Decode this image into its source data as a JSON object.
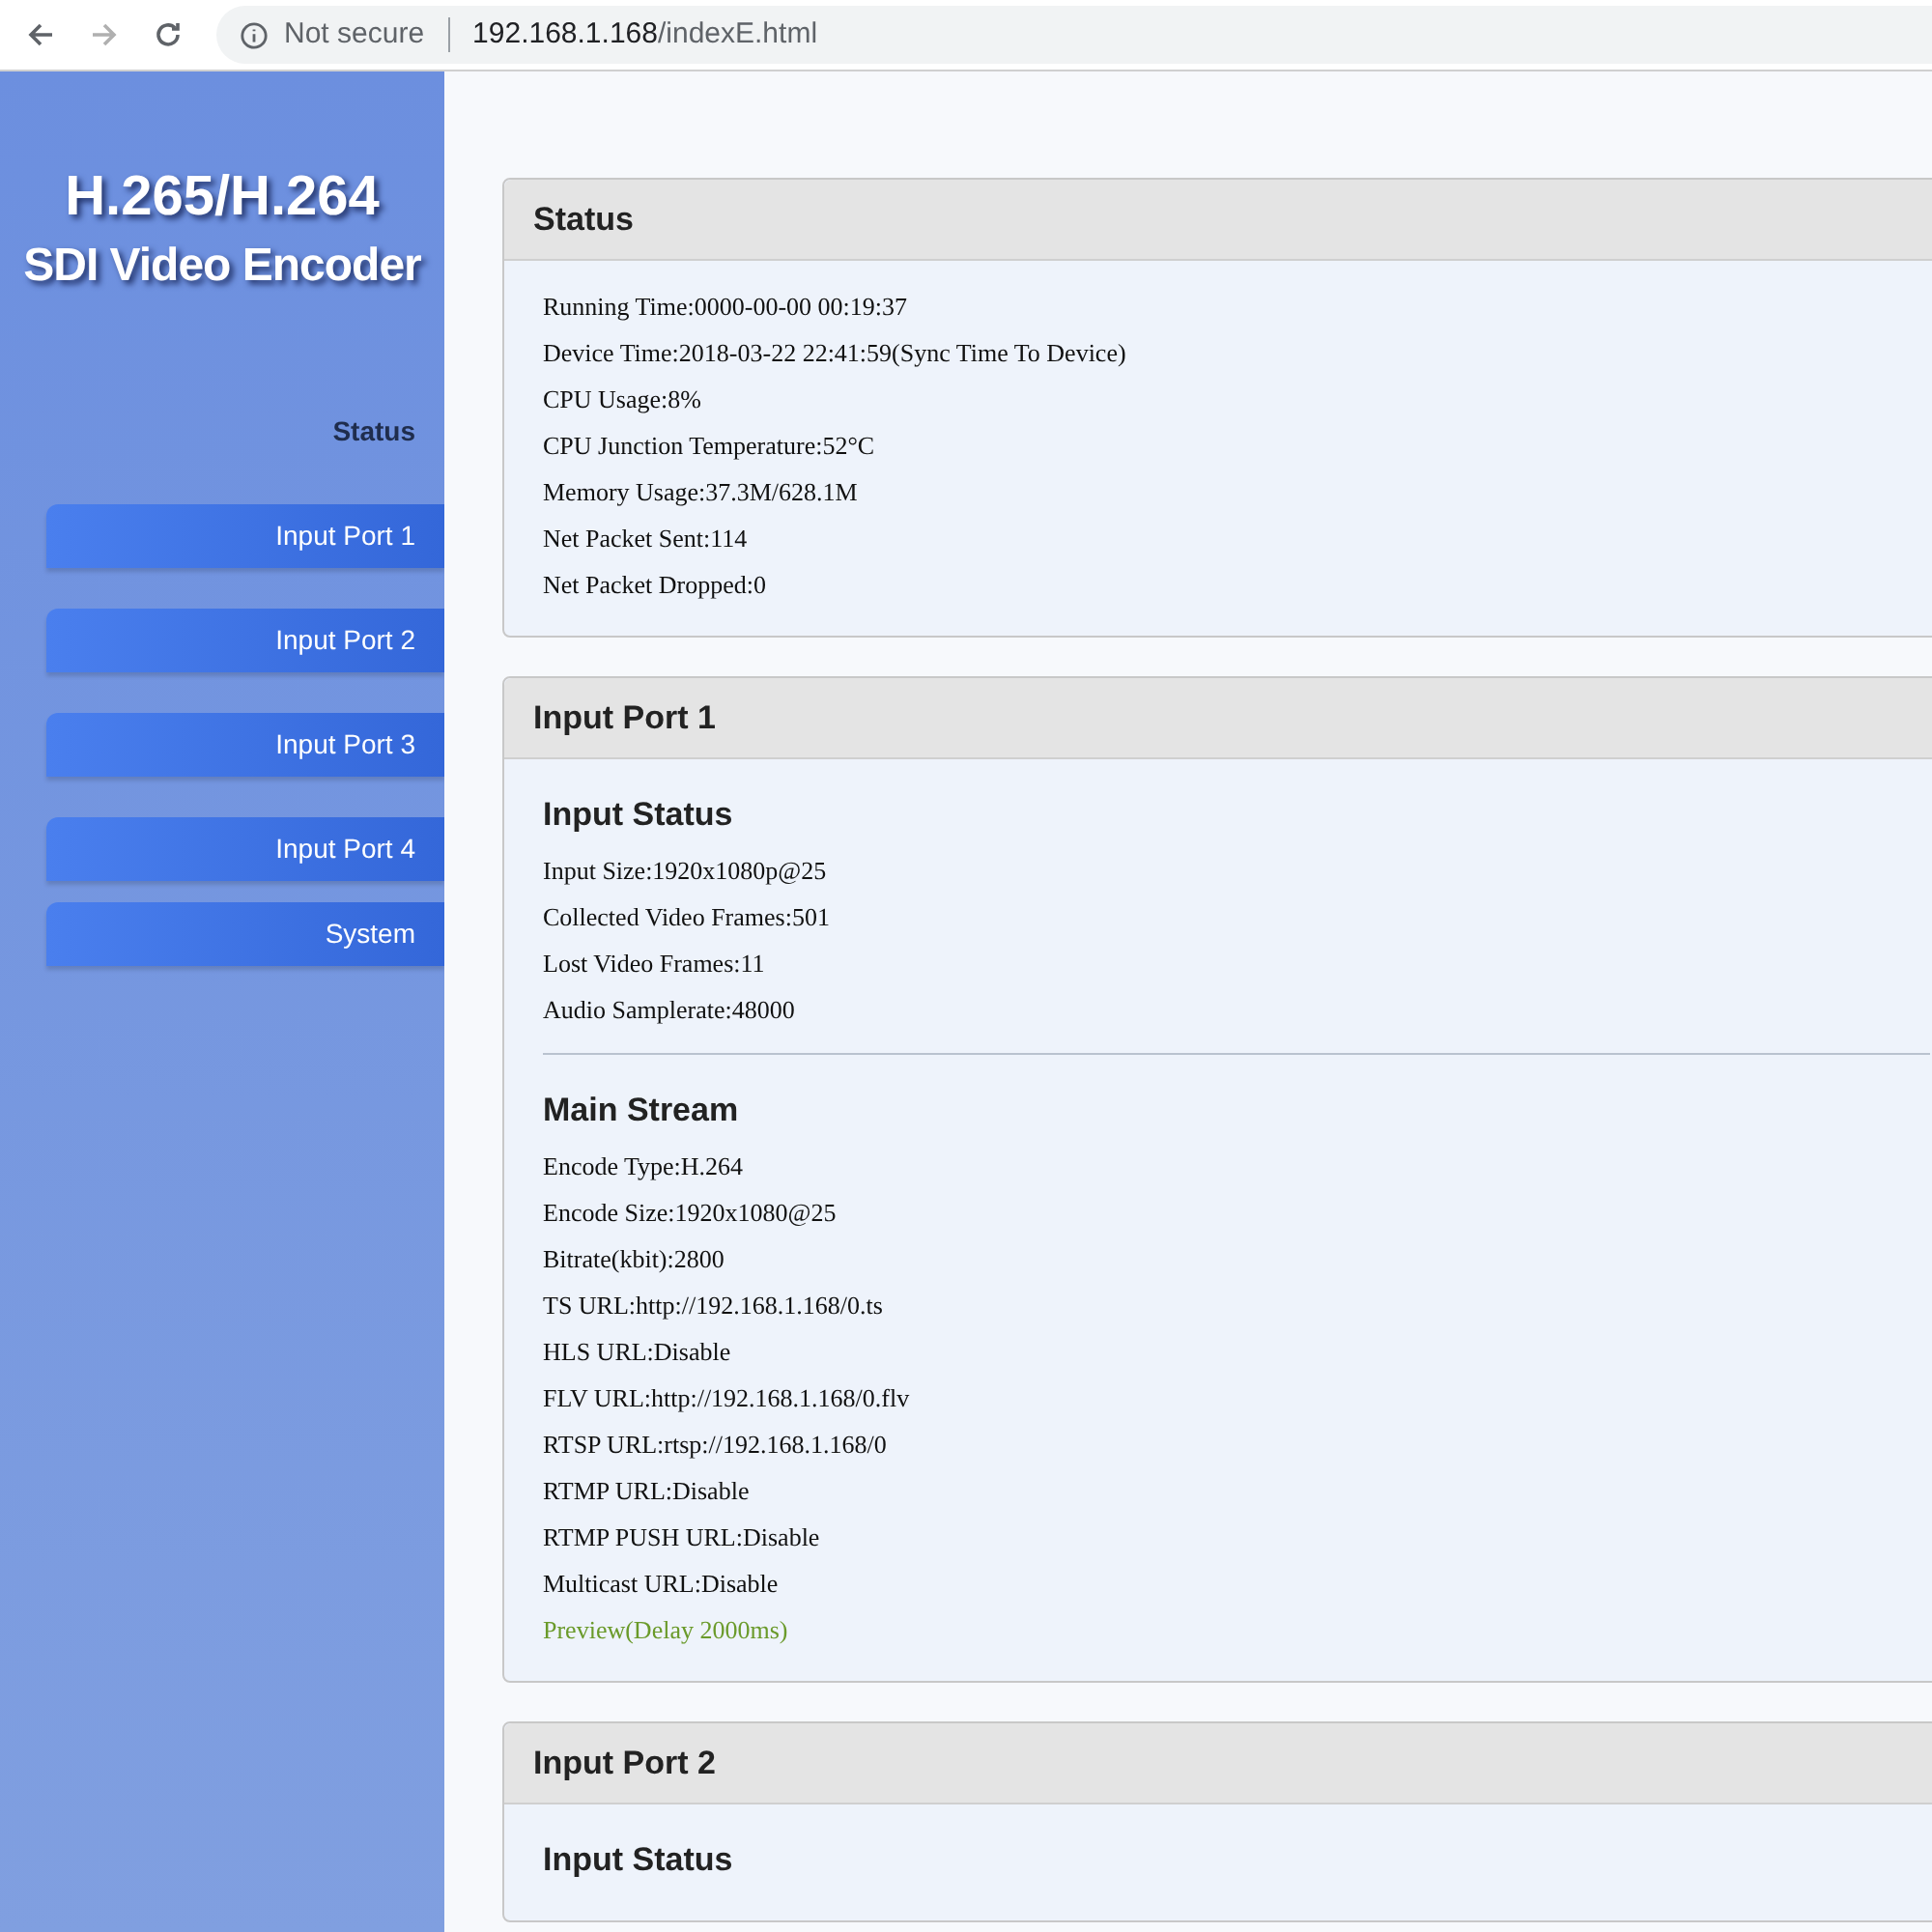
{
  "browser": {
    "back_disabled": false,
    "forward_disabled": true,
    "security": "Not secure",
    "url_host": "192.168.1.168",
    "url_path": "/indexE.html"
  },
  "sidebar": {
    "logo_line_1": "H.265/H.264",
    "logo_line_2": "SDI Video Encoder",
    "items": [
      {
        "label": "Status",
        "selected": true
      },
      {
        "label": "Input Port 1",
        "selected": false
      },
      {
        "label": "Input Port 2",
        "selected": false
      },
      {
        "label": "Input Port 3",
        "selected": false
      },
      {
        "label": "Input Port 4",
        "selected": false
      },
      {
        "label": "System",
        "selected": false
      }
    ]
  },
  "panels": [
    {
      "title": "Status",
      "sections": [
        {
          "lines": [
            {
              "kind": "text",
              "text": "Running Time:0000-00-00 00:19:37"
            },
            {
              "kind": "text",
              "text": "Device Time:2018-03-22 22:41:59(Sync Time To Device)"
            },
            {
              "kind": "text",
              "text": "CPU Usage:8%"
            },
            {
              "kind": "text",
              "text": "CPU Junction Temperature:52°C"
            },
            {
              "kind": "text",
              "text": "Memory Usage:37.3M/628.1M"
            },
            {
              "kind": "text",
              "text": "Net Packet Sent:114"
            },
            {
              "kind": "text",
              "text": "Net Packet Dropped:0"
            }
          ]
        }
      ]
    },
    {
      "title": "Input Port 1",
      "sections": [
        {
          "heading": "Input Status",
          "lines": [
            {
              "kind": "text",
              "text": "Input Size:1920x1080p@25"
            },
            {
              "kind": "text",
              "text": "Collected Video Frames:501"
            },
            {
              "kind": "text",
              "text": "Lost Video Frames:11"
            },
            {
              "kind": "text",
              "text": "Audio Samplerate:48000"
            }
          ]
        },
        {
          "heading": "Main Stream",
          "lines": [
            {
              "kind": "text",
              "text": "Encode Type:H.264"
            },
            {
              "kind": "text",
              "text": "Encode Size:1920x1080@25"
            },
            {
              "kind": "text",
              "text": "Bitrate(kbit):2800"
            },
            {
              "kind": "text",
              "text": "TS URL:http://192.168.1.168/0.ts"
            },
            {
              "kind": "text",
              "text": "HLS URL:Disable"
            },
            {
              "kind": "text",
              "text": "FLV URL:http://192.168.1.168/0.flv"
            },
            {
              "kind": "text",
              "text": "RTSP URL:rtsp://192.168.1.168/0"
            },
            {
              "kind": "text",
              "text": "RTMP URL:Disable"
            },
            {
              "kind": "text",
              "text": "RTMP PUSH URL:Disable"
            },
            {
              "kind": "text",
              "text": "Multicast URL:Disable"
            },
            {
              "kind": "link",
              "text": "Preview(Delay 2000ms)"
            }
          ]
        }
      ]
    },
    {
      "title": "Input Port 2",
      "sections": [
        {
          "heading": "Input Status"
        }
      ]
    }
  ]
}
